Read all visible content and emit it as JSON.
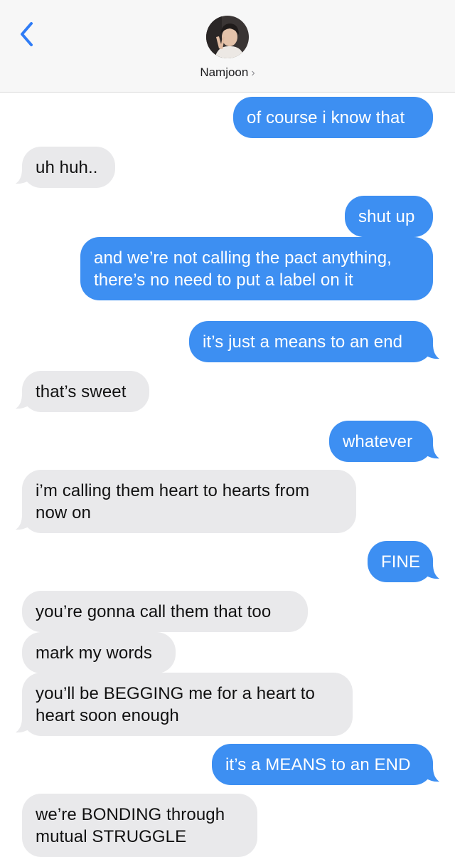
{
  "header": {
    "contact_name": "Namjoon",
    "chevron": "›",
    "back_icon": "chevron-left-icon",
    "accent": "#2f7cf6"
  },
  "colors": {
    "outgoing_bubble": "#3d8ff2",
    "incoming_bubble": "#e9e9eb"
  },
  "messages": [
    {
      "dir": "out",
      "text": "of course i know that"
    },
    {
      "dir": "in",
      "text": "uh huh.."
    },
    {
      "dir": "out",
      "text": "shut up"
    },
    {
      "dir": "out",
      "text": "and we’re not calling the pact anything, there’s no need to put a label on it"
    },
    {
      "dir": "out",
      "text": "it’s just a means to an end"
    },
    {
      "dir": "in",
      "text": "that’s sweet"
    },
    {
      "dir": "out",
      "text": "whatever"
    },
    {
      "dir": "in",
      "text": "i’m calling them heart to hearts from now on"
    },
    {
      "dir": "out",
      "text": "FINE"
    },
    {
      "dir": "in",
      "text": "you’re gonna call them that too"
    },
    {
      "dir": "in",
      "text": "mark my words"
    },
    {
      "dir": "in",
      "text": "you’ll be BEGGING me for a heart to heart soon enough"
    },
    {
      "dir": "out",
      "text": "it’s a MEANS to an END"
    },
    {
      "dir": "in",
      "text": "we’re BONDING through mutual STRUGGLE"
    }
  ]
}
